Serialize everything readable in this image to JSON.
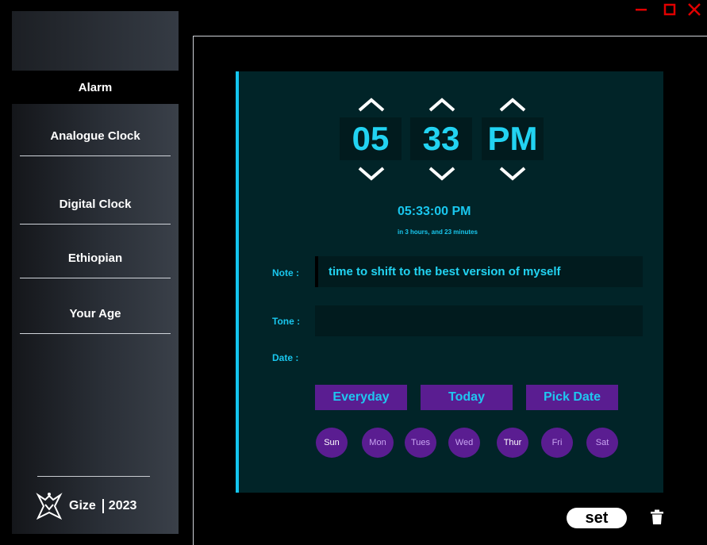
{
  "window": {
    "minimize_icon": "minimize-icon",
    "maximize_icon": "maximize-icon",
    "close_icon": "close-icon",
    "control_color": "#e00000"
  },
  "sidebar": {
    "active_item": "Alarm",
    "items": [
      {
        "label": "Analogue Clock"
      },
      {
        "label": "Digital Clock"
      },
      {
        "label": "Ethiopian"
      },
      {
        "label": "Your Age"
      }
    ],
    "brand": {
      "name": "Gize",
      "year": "2023",
      "logo_icon": "gize-logo-icon"
    }
  },
  "alarm": {
    "hour": "05",
    "minute": "33",
    "period": "PM",
    "time_readout": "05:33:00 PM",
    "time_remaining": "in 3 hours, and 23 minutes",
    "note_label": "Note :",
    "note_value": "time to shift to the best version of myself",
    "tone_label": "Tone :",
    "tone_value": "",
    "date_label": "Date :",
    "date_options": [
      "Everyday",
      "Today",
      "Pick Date"
    ],
    "days": [
      {
        "label": "Sun",
        "selected": true
      },
      {
        "label": "Mon",
        "selected": false
      },
      {
        "label": "Tues",
        "selected": false
      },
      {
        "label": "Wed",
        "selected": false
      },
      {
        "label": "Thur",
        "selected": true
      },
      {
        "label": "Fri",
        "selected": false
      },
      {
        "label": "Sat",
        "selected": false
      }
    ]
  },
  "actions": {
    "set_label": "set",
    "delete_icon": "trash-icon"
  },
  "colors": {
    "accent": "#19c7ee",
    "panel_bg": "#012428",
    "field_bg": "#011b1e",
    "purple": "#5a1d91"
  }
}
